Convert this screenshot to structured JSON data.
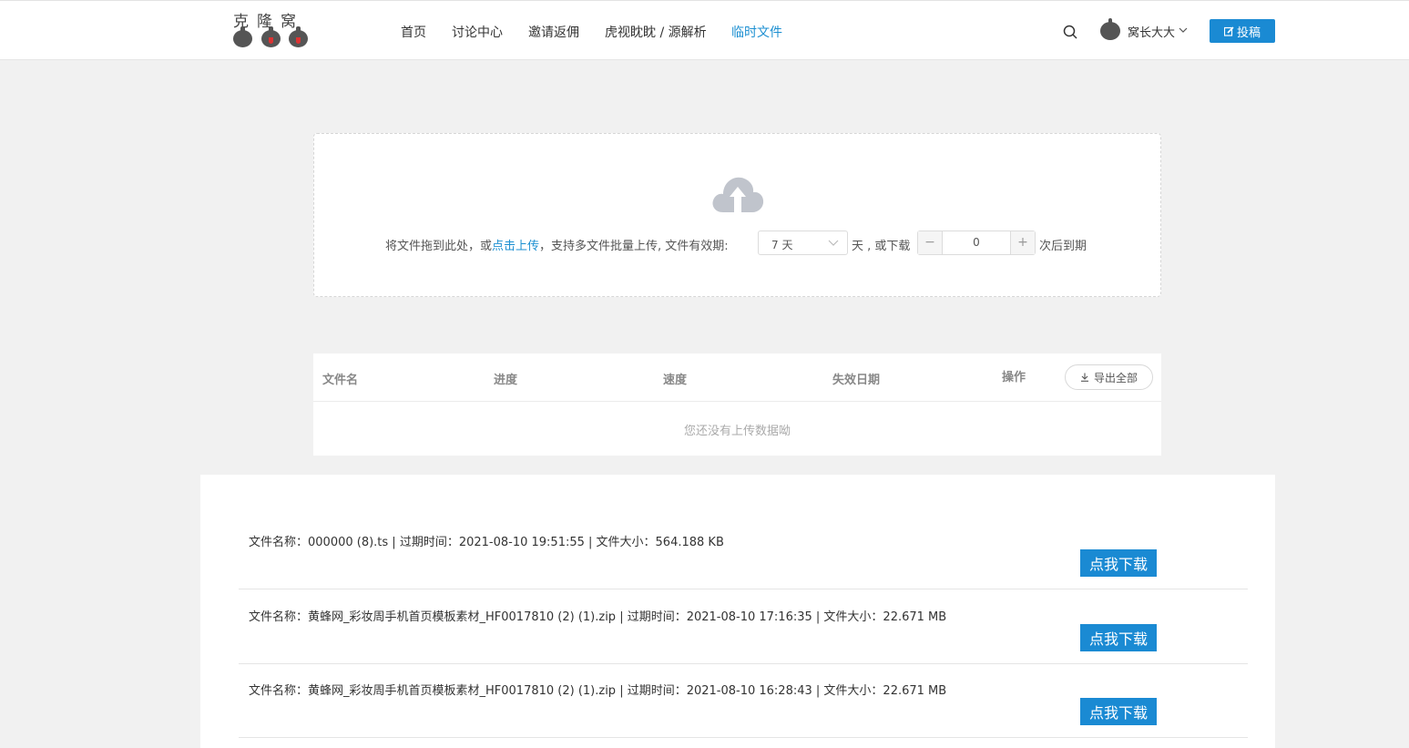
{
  "header": {
    "logo_text": "克隆窝",
    "nav": [
      {
        "label": "首页"
      },
      {
        "label": "讨论中心"
      },
      {
        "label": "邀请返佣"
      },
      {
        "label": "虎视眈眈 / 源解析"
      },
      {
        "label": "临时文件",
        "active": true
      }
    ],
    "username": "窝长大大",
    "post_button": "投稿",
    "accent_color": "#1a8ad3"
  },
  "upload": {
    "text_before_link": "将文件拖到此处，或",
    "link_text": "点击上传",
    "text_after_link": "，支持多文件批量上传, 文件有效期:",
    "validity_select_value": "7 天",
    "text_days": "天 , 或下载",
    "download_count": "0",
    "stepper_minus": "−",
    "stepper_plus": "+",
    "text_expire": "次后到期"
  },
  "table": {
    "columns": [
      "文件名",
      "进度",
      "速度",
      "失效日期",
      "操作"
    ],
    "export_button": "导出全部",
    "empty_text": "您还没有上传数据呦"
  },
  "files": [
    {
      "info": "文件名称：000000 (8).ts | 过期时间：2021-08-10 19:51:55 | 文件大小：564.188 KB",
      "button": "点我下载"
    },
    {
      "info": "文件名称：黄蜂网_彩妆周手机首页模板素材_HF0017810 (2) (1).zip | 过期时间：2021-08-10 17:16:35 | 文件大小：22.671 MB",
      "button": "点我下载"
    },
    {
      "info": "文件名称：黄蜂网_彩妆周手机首页模板素材_HF0017810 (2) (1).zip | 过期时间：2021-08-10 16:28:43 | 文件大小：22.671 MB",
      "button": "点我下载"
    }
  ]
}
